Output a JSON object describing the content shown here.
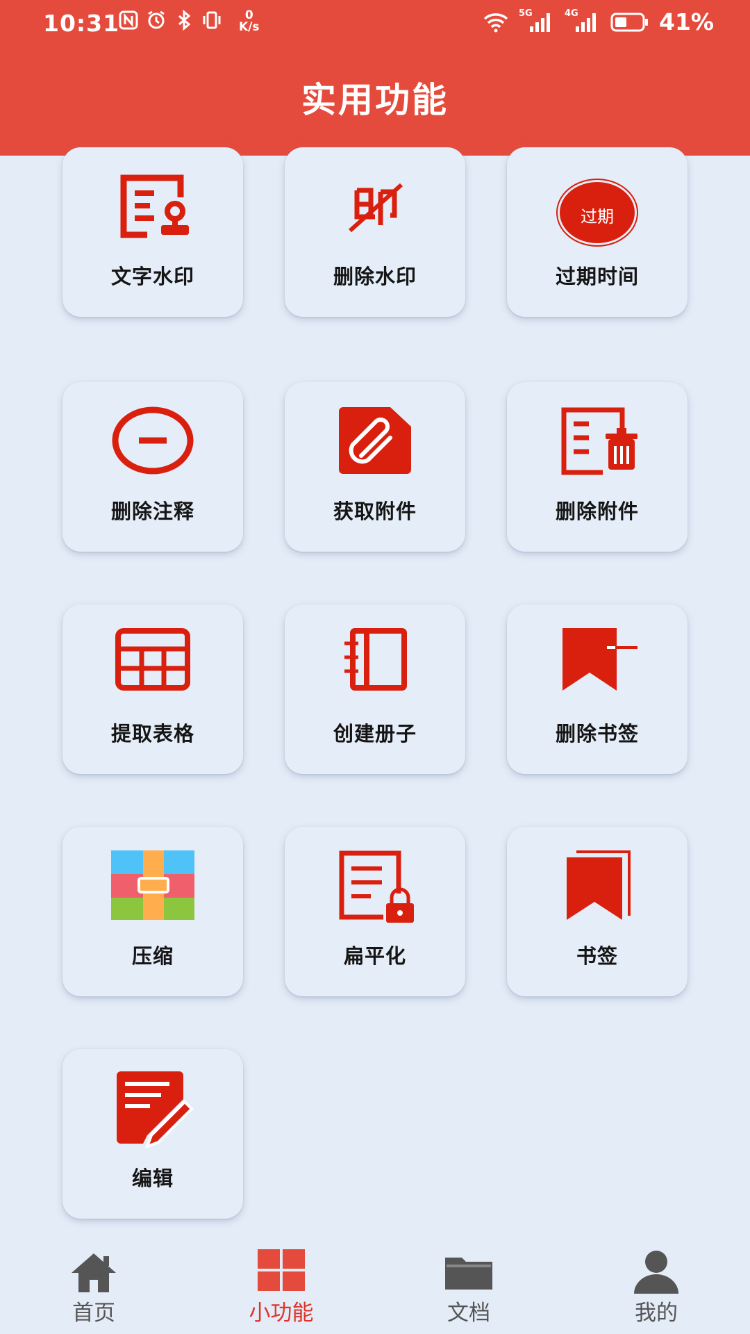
{
  "status_bar": {
    "time": "10:31",
    "net_speed_value": "0",
    "net_speed_unit": "K/s",
    "signal_1": "5G",
    "signal_2": "4G",
    "battery": "41%"
  },
  "header": {
    "title": "实用功能"
  },
  "tools": [
    {
      "label": "文字水印",
      "icon": "text-watermark-icon"
    },
    {
      "label": "删除水印",
      "icon": "remove-watermark-icon"
    },
    {
      "label": "过期时间",
      "icon": "expiry-stamp-icon",
      "stamp_text": "过期"
    },
    {
      "label": "删除注释",
      "icon": "remove-annotation-icon"
    },
    {
      "label": "获取附件",
      "icon": "attachment-icon"
    },
    {
      "label": "删除附件",
      "icon": "delete-attachment-icon"
    },
    {
      "label": "提取表格",
      "icon": "table-icon"
    },
    {
      "label": "创建册子",
      "icon": "booklet-icon"
    },
    {
      "label": "删除书签",
      "icon": "delete-bookmark-icon"
    },
    {
      "label": "压缩",
      "icon": "compress-icon"
    },
    {
      "label": "扁平化",
      "icon": "flatten-icon"
    },
    {
      "label": "书签",
      "icon": "bookmark-icon"
    },
    {
      "label": "编辑",
      "icon": "edit-icon"
    }
  ],
  "bottom_nav": [
    {
      "label": "首页",
      "icon": "home-icon"
    },
    {
      "label": "小功能",
      "icon": "grid-icon",
      "active": true
    },
    {
      "label": "文档",
      "icon": "folder-icon"
    },
    {
      "label": "我的",
      "icon": "user-icon"
    }
  ],
  "colors": {
    "accent": "#e54b3c",
    "icon_red": "#d9200f",
    "background": "#e4ecf7"
  }
}
